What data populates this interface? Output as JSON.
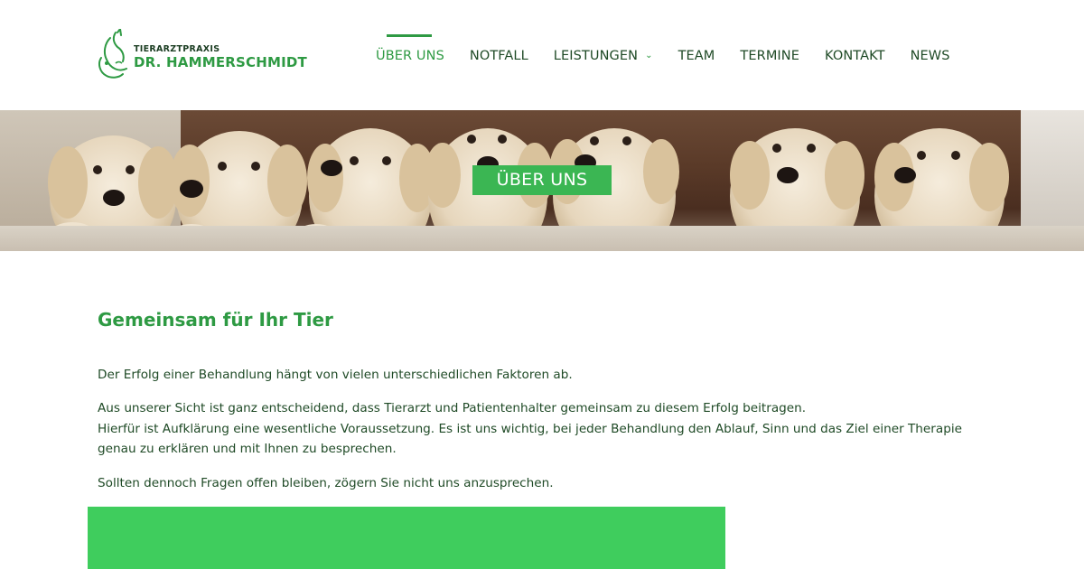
{
  "brand": {
    "small": "TIERARZTPRAXIS",
    "name": "DR. HAMMERSCHMIDT",
    "colors": {
      "green": "#2e9a43",
      "accent_box": "#3fcd5d",
      "label_bg": "#3bb653",
      "text": "#1f4a26"
    }
  },
  "nav": {
    "items": [
      {
        "label": "ÜBER UNS",
        "active": true
      },
      {
        "label": "NOTFALL"
      },
      {
        "label": "LEISTUNGEN",
        "icon": "chevron-down-icon"
      },
      {
        "label": "TEAM"
      },
      {
        "label": "TERMINE"
      },
      {
        "label": "KONTAKT"
      },
      {
        "label": "NEWS"
      }
    ]
  },
  "hero": {
    "label": "ÜBER UNS",
    "image": "golden-retriever-puppies"
  },
  "main": {
    "title": "Gemeinsam für Ihr Tier",
    "paragraphs": [
      "Der Erfolg einer Behandlung hängt von vielen unterschiedlichen Faktoren ab.",
      "Aus unserer Sicht ist ganz entscheidend, dass Tierarzt und Patientenhalter gemeinsam zu diesem Erfolg beitragen.",
      "Hierfür ist Aufklärung eine wesentliche Voraussetzung. Es ist uns wichtig, bei jeder Behandlung den Ablauf, Sinn und das Ziel einer Therapie genau zu erklären und mit Ihnen zu besprechen.",
      "Sollten dennoch Fragen offen bleiben, zögern Sie nicht uns anzusprechen."
    ]
  }
}
